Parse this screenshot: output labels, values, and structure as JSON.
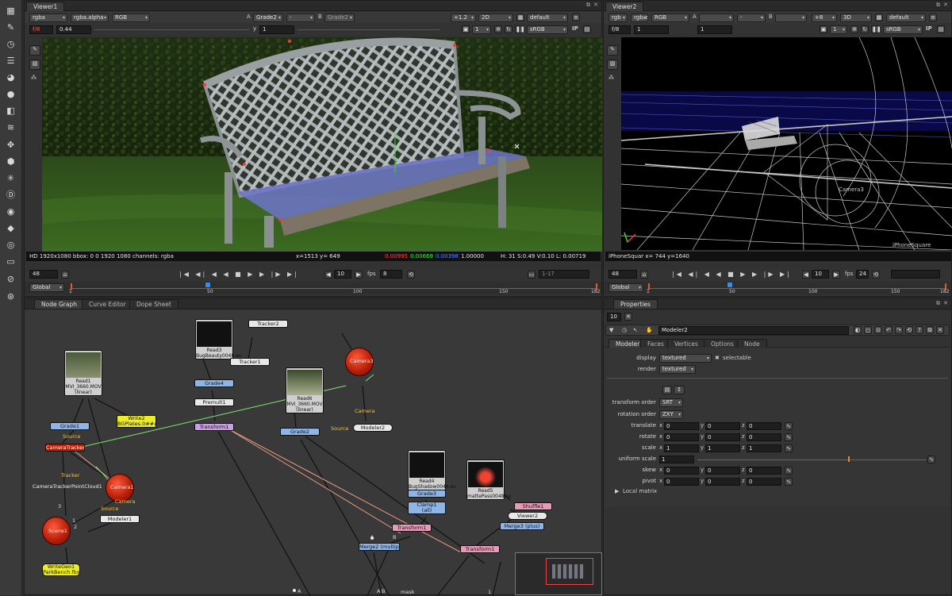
{
  "toolbar": {
    "icons": [
      "grid-icon",
      "pencil-icon",
      "clock-icon",
      "stack-icon",
      "palette-icon",
      "circle-icon",
      "layers-icon",
      "filter-icon",
      "move-icon",
      "cube-icon",
      "asterisk-icon",
      "d-icon",
      "eye-icon",
      "tag-icon",
      "ring-icon",
      "box-icon",
      "nuke-icon",
      "sphere-icon"
    ]
  },
  "viewer1": {
    "tab": "Viewer1",
    "channels": "rgba",
    "alpha": "rgba.alpha",
    "mode": "RGB",
    "a_label": "A",
    "a_input": "Grade2",
    "a_op": "-",
    "b_label": "B",
    "b_input": "Grade2",
    "zoom": "+1.2",
    "view": "2D",
    "lut_default": "default",
    "fstop": "f/8",
    "gain": "0.44",
    "y_label": "y",
    "gamma": "1",
    "frame_small": "1",
    "colorspace": "sRGB",
    "ip": "IP",
    "info": "HD 1920x1080 bbox: 0 0 1920 1080 channels: rgba",
    "coords": "x=1513 y= 649",
    "pix_r": "0.00995",
    "pix_g": "0.00669",
    "pix_b": "0.00398",
    "pix_a": "1.00000",
    "hsvl": "H: 31 S:0.49 V:0.10  L: 0.00719",
    "frame": "48",
    "step": "10",
    "fps_label": "fps",
    "fps": "8",
    "range": "1-17",
    "global": "Global",
    "ticks": [
      "1",
      "50",
      "100",
      "150",
      "182"
    ]
  },
  "viewer2": {
    "tab": "Viewer2",
    "channels": "rgb",
    "alpha": "rgb.alpha",
    "mode": "RGB",
    "a_label": "A",
    "a_op": "-",
    "b_label": "B",
    "zoom": "+8",
    "view": "3D",
    "lut_default": "default",
    "fstop": "f/8",
    "gain": "1",
    "gamma": "1",
    "frame_small": "1",
    "colorspace": "sRGB",
    "ip": "IP",
    "camera_label": "Camera3",
    "view_label": "iPhoneSquare",
    "info": "iPhoneSquar  x= 744 y=1640",
    "frame": "48",
    "step": "10",
    "fps_label": "fps",
    "fps": "24",
    "global": "Global",
    "ticks": [
      "1",
      "50",
      "100",
      "150",
      "182"
    ]
  },
  "nodegraph": {
    "tabs": [
      "Node Graph",
      "Curve Editor",
      "Dope Sheet"
    ],
    "nodes": {
      "read1": "Read1\nMVI_3660.MOV\n(linear)",
      "read3": "Read3\nBugBeauty0048.ex",
      "read6": "Read6\nMVI_3660.MOV\n(linear)",
      "read4": "Read4\nBugShadow0048.ex",
      "read5": "Read5\nmattePass0048.ex",
      "tracker2": "Tracker2",
      "tracker1": "Tracker1",
      "grade4": "Grade4",
      "premult1": "Premult1",
      "transform1": "Transform1",
      "grade1": "Grade1",
      "write2": "Write2\nBGPlates.0###.jpg",
      "cameratracker": "CameraTracker1",
      "camera_tracker_pointcloud": "CameraTrackerPointCloud1",
      "camera1": "Camera1",
      "scene1": "Scene1",
      "modeler1": "Modeler1",
      "writegeo": "WriteGeo1\nParkBench.fbx",
      "camera3": "Camera3",
      "modeler2": "Modeler2",
      "grade2": "Grade2",
      "grade3": "Grade3",
      "clamp1": "Clamp1\n(all)",
      "transform_a": "Transform1",
      "merge2": "Merge2 (multiply)",
      "shuffle": "Shuffle1",
      "viewer2n": "Viewer2",
      "merge3": "Merge3 (plus)",
      "transform_b": "Transform1",
      "source1": "Source",
      "source2": "Source",
      "source3": "Source",
      "tracker_lbl": "Tracker",
      "camera_lbl1": "Camera",
      "camera_lbl2": "Camera",
      "mask": "mask",
      "a1": "A",
      "b1": "B",
      "a2": "A",
      "a3": "A",
      "b3": "B",
      "num3": "3",
      "num1": "1",
      "num2": "2",
      "num3b": "3",
      "num1b": "1"
    }
  },
  "properties": {
    "tab": "Properties",
    "count": "10",
    "node_name": "Modeler2",
    "tabs": [
      "Modeler",
      "Faces",
      "Vertices",
      "Options",
      "Node"
    ],
    "display_label": "display",
    "display_value": "textured",
    "selectable": "selectable",
    "render_label": "render",
    "render_value": "textured",
    "transform_order_label": "transform order",
    "transform_order": "SRT",
    "rotation_order_label": "rotation order",
    "rotation_order": "ZXY",
    "translate_label": "translate",
    "rotate_label": "rotate",
    "scale_label": "scale",
    "uniform_scale_label": "uniform scale",
    "skew_label": "skew",
    "pivot_label": "pivot",
    "x": "x",
    "y": "y",
    "z": "z",
    "translate": [
      "0",
      "0",
      "0"
    ],
    "rotate": [
      "0",
      "0",
      "0"
    ],
    "scale": [
      "1",
      "1",
      "1"
    ],
    "uniform_scale": "1",
    "skew": [
      "0",
      "0",
      "0"
    ],
    "pivot": [
      "0",
      "0",
      "0"
    ],
    "local_matrix": "Local matrix"
  }
}
